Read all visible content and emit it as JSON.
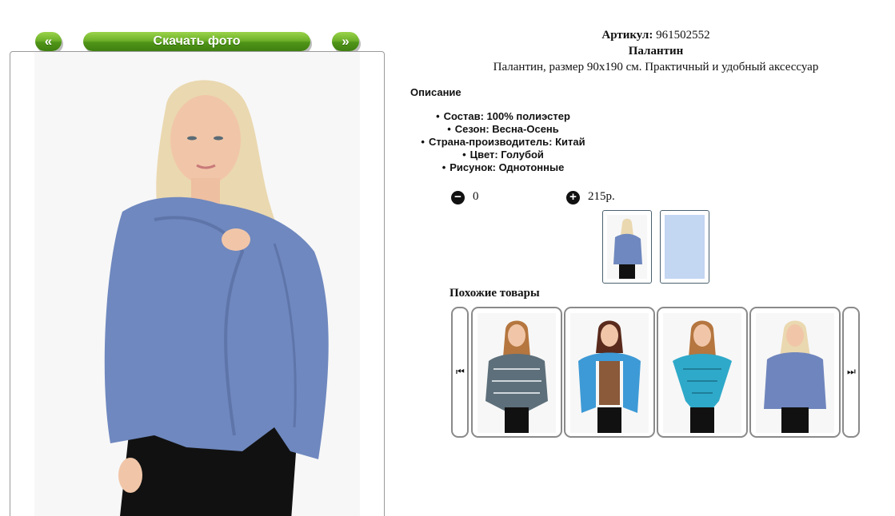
{
  "nav": {
    "prev_label": "«",
    "download_label": "Скачать фото",
    "next_label": "»"
  },
  "product": {
    "article_label": "Артикул:",
    "article_value": "961502552",
    "name": "Палантин",
    "description": "Палантин, размер 90х190 см. Практичный и удобный аксессуар",
    "description_heading": "Описание",
    "properties": [
      "Состав: 100% полиэстер",
      "Сезон: Весна-Осень",
      "Страна-производитель: Китай",
      "Цвет: Голубой",
      "Рисунок: Однотонные"
    ],
    "quantity": "0",
    "price": "215р."
  },
  "similar": {
    "title": "Похожие товары",
    "items": [
      {
        "scarf_color": "#5d6f7a"
      },
      {
        "scarf_color": "#3d9ad6"
      },
      {
        "scarf_color": "#2fa9c9"
      },
      {
        "scarf_color": "#6f85bd"
      }
    ]
  },
  "colors": {
    "button_green": "#6fb12a",
    "scarf_blue": "#6f88bf",
    "thumb_fabric": "#c3d6f2"
  },
  "icons": {
    "minus": "minus-circle-icon",
    "plus": "plus-circle-icon",
    "carousel_prev": "skip-back-icon",
    "carousel_next": "skip-forward-icon"
  }
}
